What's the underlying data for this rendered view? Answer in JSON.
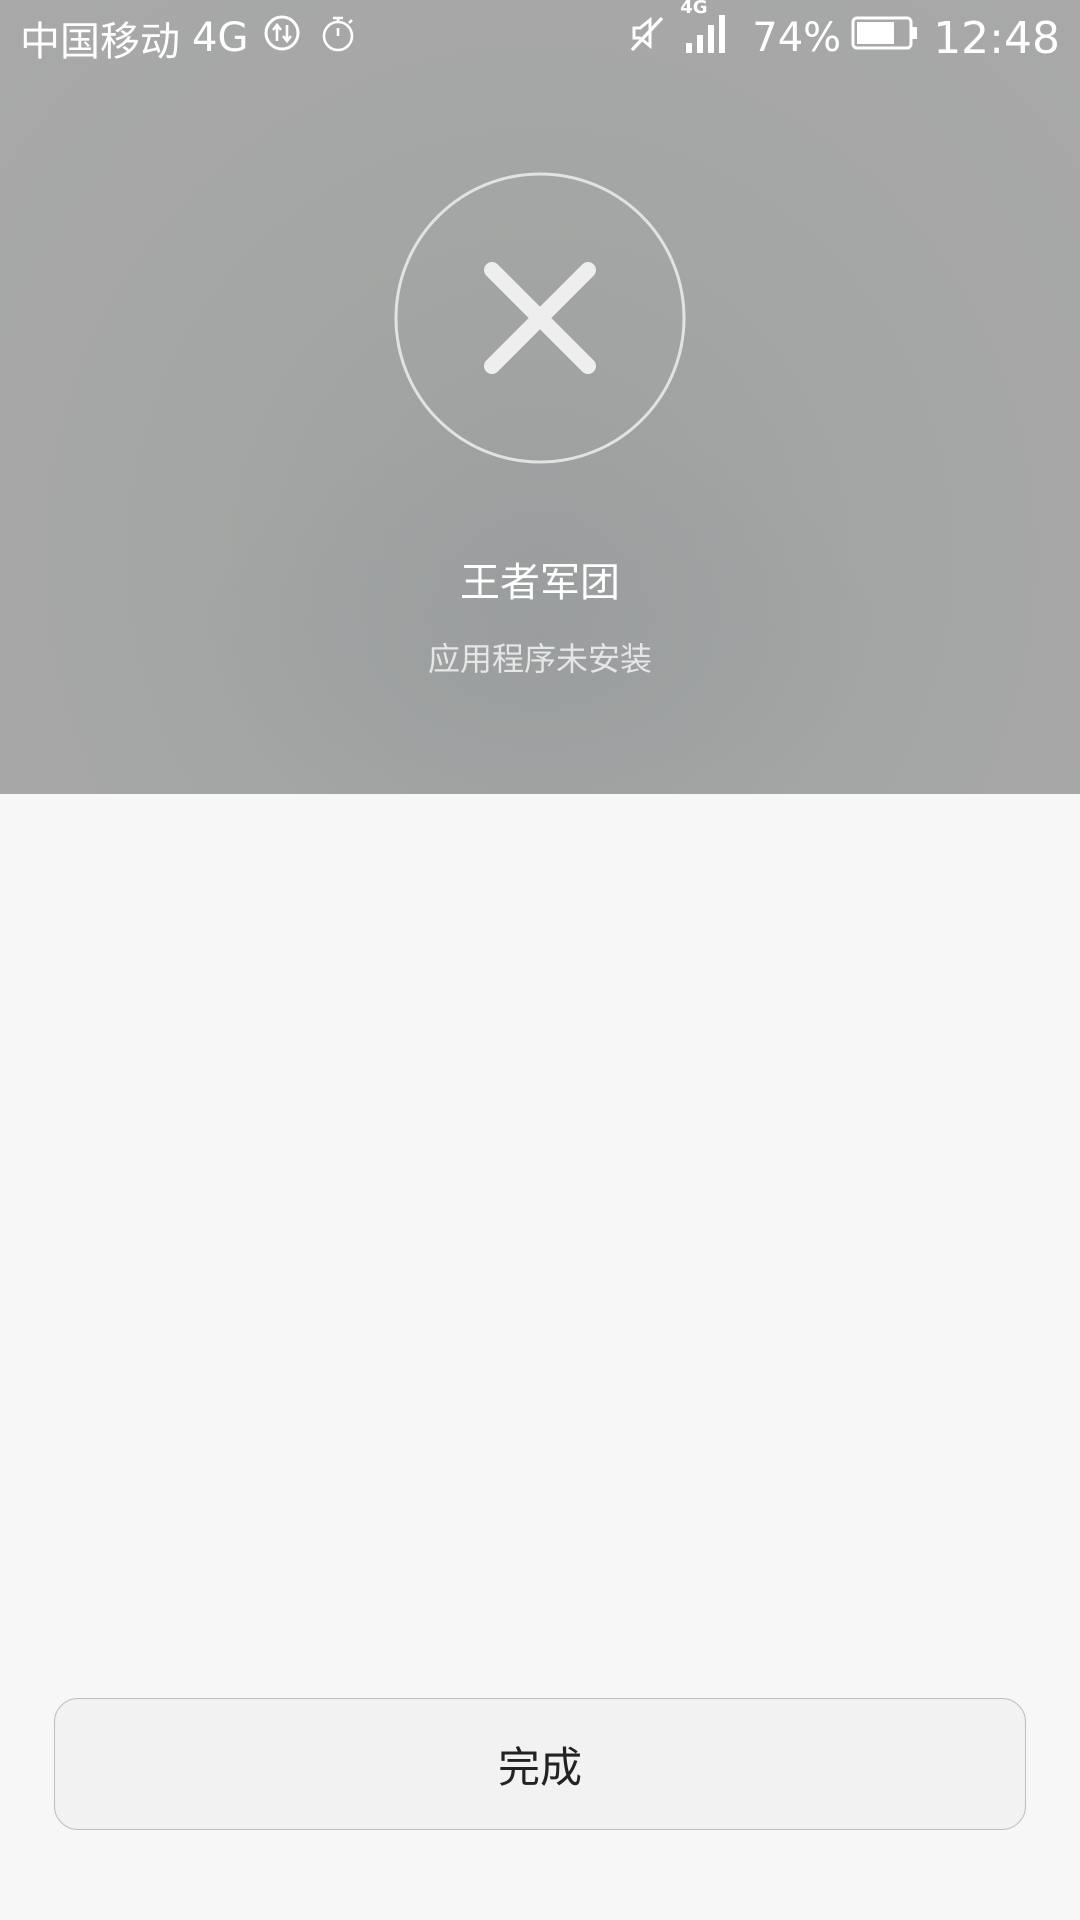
{
  "status_bar": {
    "carrier": "中国移动",
    "network": "4G",
    "signal_network_label": "4G",
    "battery_percent": "74%",
    "battery_level": 0.74,
    "time": "12:48",
    "icons": [
      "data-transfer-icon",
      "timer-icon",
      "vibrate-mute-icon",
      "signal-icon",
      "battery-icon"
    ]
  },
  "result": {
    "icon": "close-icon",
    "app_name": "王者军团",
    "message": "应用程序未安装"
  },
  "actions": {
    "done_label": "完成"
  },
  "colors": {
    "header_bg": "#a6a7a6",
    "body_bg": "#f7f7f7",
    "button_bg": "#f2f2f2",
    "button_border": "#bdbdbd",
    "icon_white": "#eeeeee"
  }
}
